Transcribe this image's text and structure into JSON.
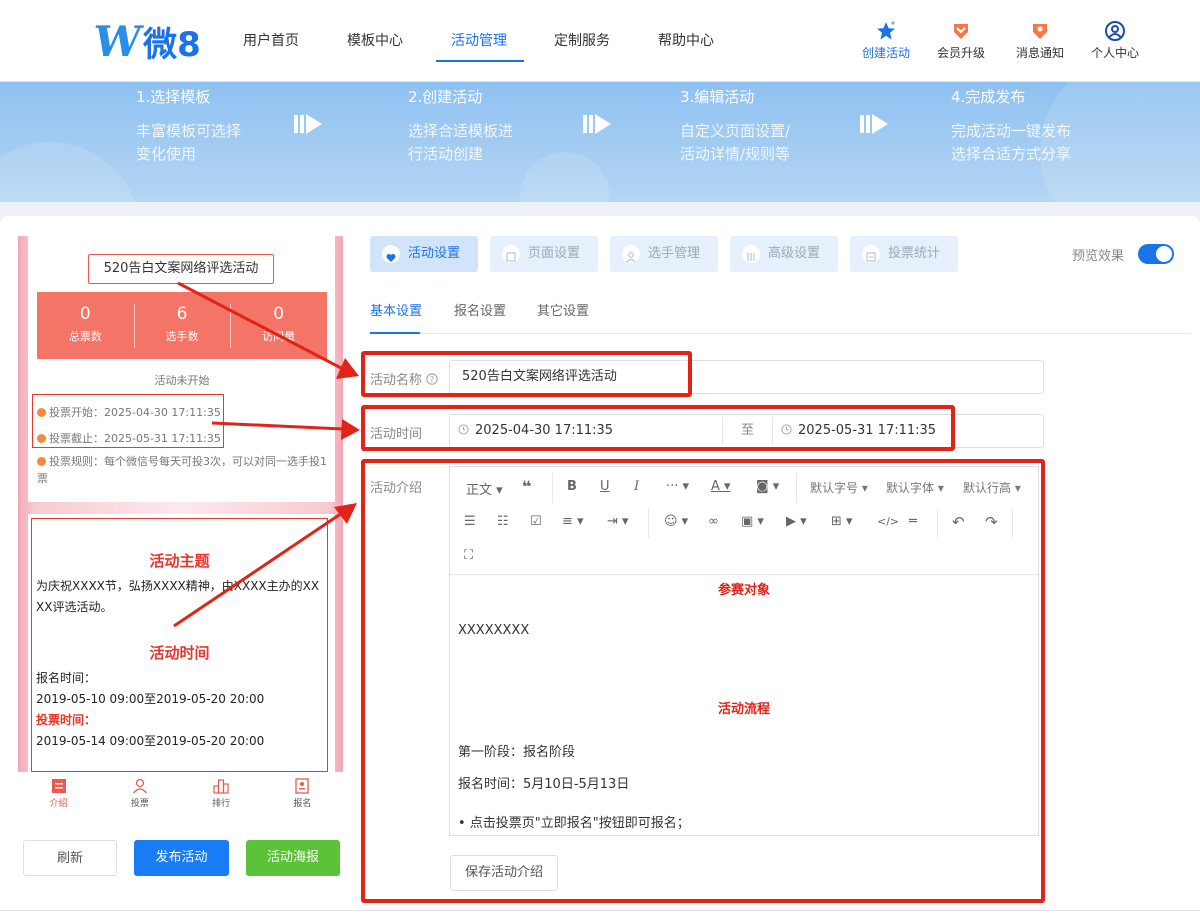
{
  "header": {
    "logo_text": "微8",
    "logo_mark": "W",
    "nav": [
      "用户首页",
      "模板中心",
      "活动管理",
      "定制服务",
      "帮助中心"
    ],
    "active_nav": "活动管理",
    "icons": [
      {
        "label": "创建活动",
        "icon": "create-star-icon"
      },
      {
        "label": "会员升级",
        "icon": "member-badge-icon"
      },
      {
        "label": "消息通知",
        "icon": "message-badge-icon"
      },
      {
        "label": "个人中心",
        "icon": "user-icon"
      }
    ]
  },
  "steps": [
    {
      "title": "1.选择模板",
      "desc": "丰富模板可选择\n变化使用"
    },
    {
      "title": "2.创建活动",
      "desc": "选择合适模板进\n行活动创建"
    },
    {
      "title": "3.编辑活动",
      "desc": "自定义页面设置/\n活动详情/规则等"
    },
    {
      "title": "4.完成发布",
      "desc": "完成活动一键发布\n选择合适方式分享"
    }
  ],
  "preview": {
    "activity_title": "520告白文案网络评选活动",
    "stats": [
      {
        "value": "0",
        "label": "总票数"
      },
      {
        "value": "6",
        "label": "选手数"
      },
      {
        "value": "0",
        "label": "访问量"
      }
    ],
    "status": "活动未开始",
    "vote_start": "投票开始：2025-04-30 17:11:35",
    "vote_end": "投票截止：2025-05-31 17:11:35",
    "vote_rule": "投票规则：每个微信号每天可投3次，可以对同一选手投1票",
    "intro": {
      "theme_heading": "活动主题",
      "theme_text_1": "为庆祝XXXX节，弘扬XXXX精神，由XXXX主办的XX",
      "theme_text_2": "XX评选活动。",
      "time_heading": "活动时间",
      "signup_label": "报名时间：",
      "signup_range": "2019-05-10 09:00至2019-05-20 20:00",
      "vote_label": "投票时间：",
      "vote_range": "2019-05-14 09:00至2019-05-20 20:00"
    },
    "tabbar": [
      "介绍",
      "投票",
      "排行",
      "报名"
    ]
  },
  "actions": {
    "refresh": "刷新",
    "publish": "发布活动",
    "poster": "活动海报"
  },
  "tabs": [
    "活动设置",
    "页面设置",
    "选手管理",
    "高级设置",
    "投票统计"
  ],
  "preview_toggle_label": "预览效果",
  "preview_toggle_on": true,
  "subtabs": [
    "基本设置",
    "报名设置",
    "其它设置"
  ],
  "form": {
    "name_label": "活动名称",
    "name_value": "520告白文案网络评选活动",
    "time_label": "活动时间",
    "start_time": "2025-04-30 17:11:35",
    "to_label": "至",
    "end_time": "2025-05-31 17:11:35",
    "intro_label": "活动介绍"
  },
  "editor": {
    "toolbar": {
      "paragraph": "正文",
      "font_size": "默认字号",
      "font_family": "默认字体",
      "line_height": "默认行高"
    },
    "content": {
      "heading1": "参赛对象",
      "text1": "XXXXXXXX",
      "heading2": "活动流程",
      "stage": "第一阶段：报名阶段",
      "signup_time": "报名时间：5月10日-5月13日",
      "bullet": "• 点击投票页\"立即报名\"按钮即可报名；"
    },
    "save_button": "保存活动介绍"
  },
  "colors": {
    "accent": "#1a73e8",
    "annotation_red": "#e02418",
    "stats_bg": "#f47567",
    "publish_btn": "#1a7cf5",
    "poster_btn": "#5cc23a"
  }
}
